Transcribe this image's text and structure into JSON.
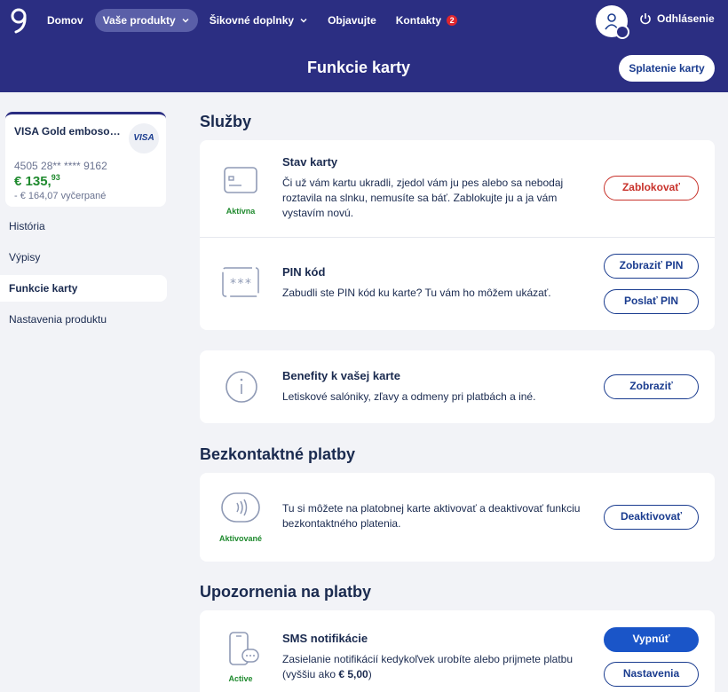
{
  "nav": {
    "items": [
      {
        "label": "Domov"
      },
      {
        "label": "Vaše produkty"
      },
      {
        "label": "Šikovné doplnky"
      },
      {
        "label": "Objavujte"
      },
      {
        "label": "Kontakty"
      }
    ],
    "contacts_badge": "2",
    "logout_label": "Odhlásenie"
  },
  "header": {
    "title": "Funkcie karty",
    "repay_button": "Splatenie karty"
  },
  "card": {
    "name": "VISA Gold embosovaná",
    "brand": "VISA",
    "number": "4505 28** **** 9162",
    "balance_main": "€ 135,",
    "balance_cents": "93",
    "used": "- € 164,07 vyčerpané"
  },
  "sidebar": {
    "items": [
      {
        "label": "História"
      },
      {
        "label": "Výpisy"
      },
      {
        "label": "Funkcie karty"
      },
      {
        "label": "Nastavenia produktu"
      }
    ]
  },
  "sections": {
    "services": {
      "title": "Služby",
      "card_status": {
        "status": "Aktívna",
        "title": "Stav karty",
        "desc": "Či už vám kartu ukradli, zjedol vám ju pes alebo sa nebodaj roztavila na slnku, nemusíte sa báť. Zablokujte ju a ja vám vystavím novú.",
        "button": "Zablokovať"
      },
      "pin": {
        "title": "PIN kód",
        "desc": "Zabudli ste PIN kód ku karte? Tu vám ho môžem ukázať.",
        "show_button": "Zobraziť PIN",
        "send_button": "Poslať PIN"
      },
      "benefits": {
        "title": "Benefity k vašej karte",
        "desc": "Letiskové salóniky, zľavy a odmeny pri platbách a iné.",
        "button": "Zobraziť"
      }
    },
    "contactless": {
      "title": "Bezkontaktné platby",
      "status": "Aktivované",
      "desc": "Tu si môžete na platobnej karte aktivovať a deaktivovať funkciu bezkontaktného platenia.",
      "button": "Deaktivovať"
    },
    "notifications": {
      "title": "Upozornenia na platby",
      "sms": {
        "status": "Active",
        "title": "SMS notifikácie",
        "desc_prefix": "Zasielanie notifikácií kedykoľvek urobíte alebo prijmete platbu (vyššiu ako ",
        "desc_amount": "€ 5,00",
        "desc_suffix": ")",
        "primary_button": "Vypnúť",
        "settings_button": "Nastavenia"
      }
    }
  },
  "colors": {
    "brand": "#2b2e82",
    "active_nav": "#5a5fa8",
    "success": "#1f8a2e",
    "danger": "#c8322b",
    "primary": "#1a55c8"
  }
}
